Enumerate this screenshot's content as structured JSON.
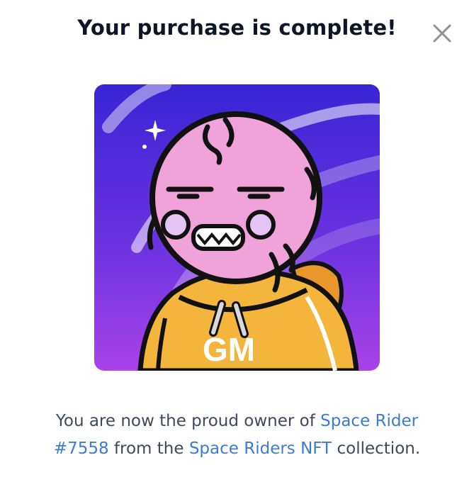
{
  "modal": {
    "title": "Your purchase is complete!",
    "close_icon": "close-icon",
    "nft": {
      "image_text": "GM"
    },
    "message": {
      "prefix": "You are now the proud owner of ",
      "item_name_line1": "Space Rider",
      "item_name_line2": "#7558",
      "middle": " from the ",
      "collection_name": "Space Riders NFT",
      "suffix": " collection."
    }
  },
  "colors": {
    "title": "#0d1526",
    "body_text": "#3d4a5c",
    "link": "#3b7bd4",
    "bg_top": "#3b25d6",
    "bg_bottom": "#a43fe6",
    "skin": "#f0a3d8",
    "hoodie": "#f3b53c"
  }
}
